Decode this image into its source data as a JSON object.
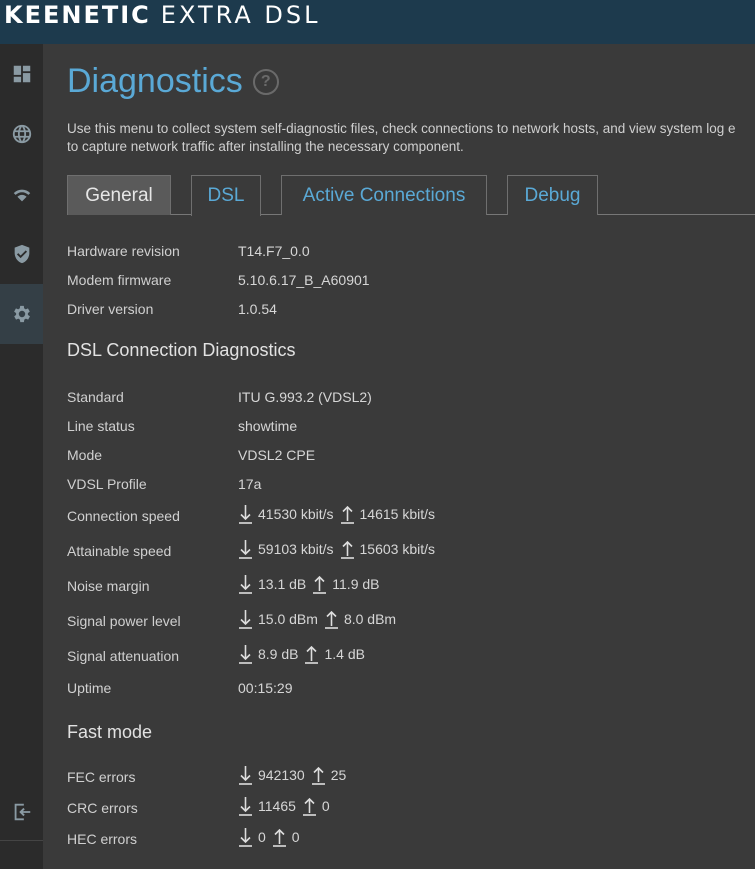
{
  "brand": {
    "name": "KEENETIC",
    "model": "EXTRA DSL"
  },
  "sidebar": {
    "items": [
      {
        "icon": "dashboard-icon"
      },
      {
        "icon": "globe-icon"
      },
      {
        "icon": "wifi-icon"
      },
      {
        "icon": "shield-icon"
      },
      {
        "icon": "gear-icon"
      }
    ],
    "bottom_icon": "logout-icon"
  },
  "page": {
    "title": "Diagnostics",
    "help": "?",
    "intro_line1": "Use this menu to collect system self-diagnostic files, check connections to network hosts, and view system log e",
    "intro_line2": "to capture network traffic after installing the necessary component."
  },
  "tabs": [
    {
      "label": "General"
    },
    {
      "label": "DSL"
    },
    {
      "label": "Active Connections"
    },
    {
      "label": "Debug"
    }
  ],
  "selected_tab": "DSL",
  "info": [
    {
      "label": "Hardware revision",
      "value": "T14.F7_0.0"
    },
    {
      "label": "Modem firmware",
      "value": "5.10.6.17_B_A60901"
    },
    {
      "label": "Driver version",
      "value": "1.0.54"
    }
  ],
  "diag": {
    "heading": "DSL Connection Diagnostics",
    "standard": {
      "label": "Standard",
      "value": "ITU G.993.2 (VDSL2)"
    },
    "line_status": {
      "label": "Line status",
      "value": "showtime"
    },
    "mode": {
      "label": "Mode",
      "value": "VDSL2 CPE"
    },
    "profile": {
      "label": "VDSL Profile",
      "value": "17a"
    },
    "connection_speed": {
      "label": "Connection speed",
      "down": "41530 kbit/s",
      "up": "14615 kbit/s"
    },
    "attainable_speed": {
      "label": "Attainable speed",
      "down": "59103 kbit/s",
      "up": "15603 kbit/s"
    },
    "noise_margin": {
      "label": "Noise margin",
      "down": "13.1 dB",
      "up": "11.9 dB"
    },
    "signal_power": {
      "label": "Signal power level",
      "down": "15.0 dBm",
      "up": "8.0 dBm"
    },
    "signal_attenuation": {
      "label": "Signal attenuation",
      "down": "8.9 dB",
      "up": "1.4 dB"
    },
    "uptime": {
      "label": "Uptime",
      "value": "00:15:29"
    }
  },
  "fast": {
    "heading": "Fast mode",
    "fec": {
      "label": "FEC errors",
      "down": "942130",
      "up": "25"
    },
    "crc": {
      "label": "CRC errors",
      "down": "11465",
      "up": "0"
    },
    "hec": {
      "label": "HEC errors",
      "down": "0",
      "up": "0"
    }
  }
}
